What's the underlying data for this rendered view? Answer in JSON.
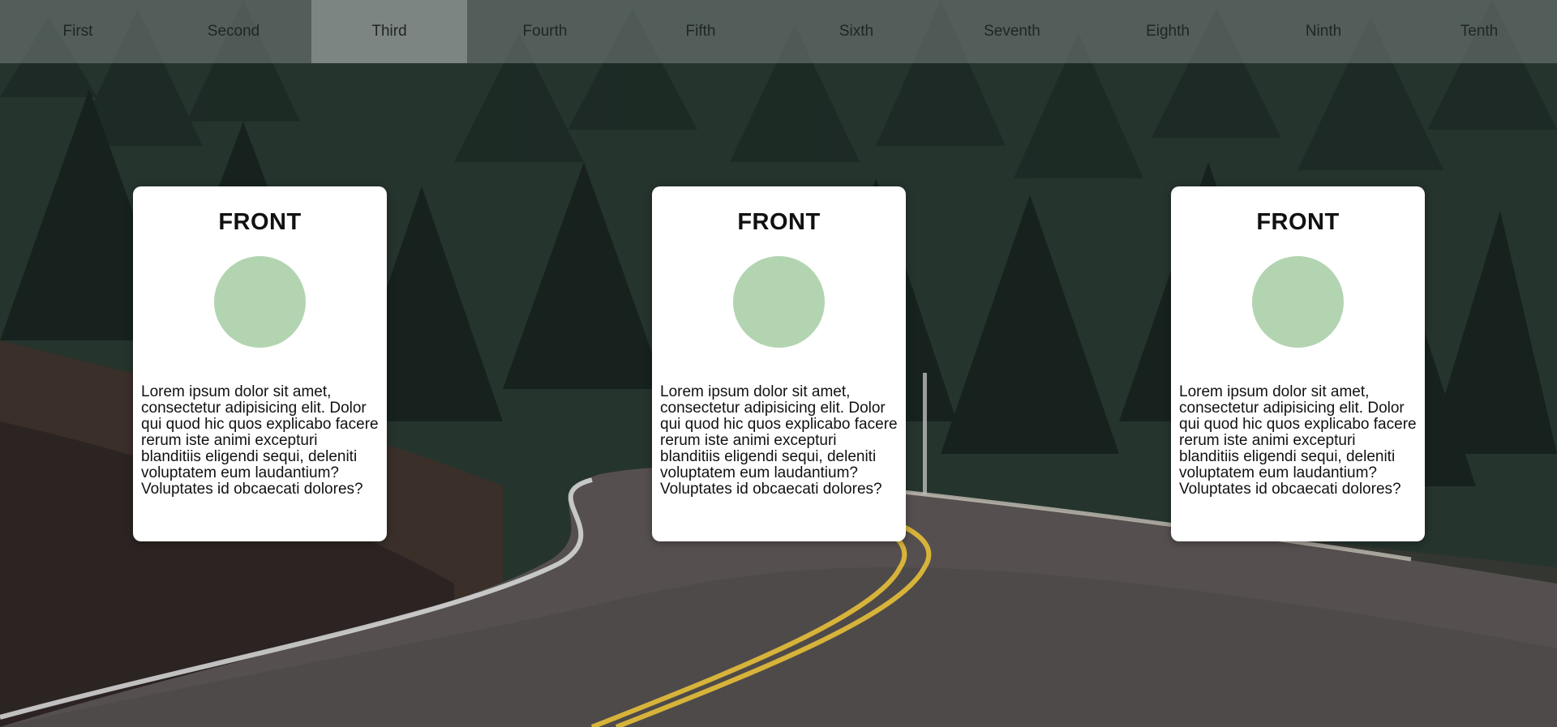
{
  "colors": {
    "nav_background": "#7a8382",
    "card_background": "#ffffff",
    "circle_fill": "#b3d4b0",
    "road_line_yellow": "#d7b33a",
    "road_edge_white": "#e6e6e6"
  },
  "nav": {
    "items": [
      {
        "label": "First",
        "active": false
      },
      {
        "label": "Second",
        "active": false
      },
      {
        "label": "Third",
        "active": true
      },
      {
        "label": "Fourth",
        "active": false
      },
      {
        "label": "Fifth",
        "active": false
      },
      {
        "label": "Sixth",
        "active": false
      },
      {
        "label": "Seventh",
        "active": false
      },
      {
        "label": "Eighth",
        "active": false
      },
      {
        "label": "Ninth",
        "active": false
      },
      {
        "label": "Tenth",
        "active": false
      }
    ]
  },
  "cards": [
    {
      "title": "FRONT",
      "text": "Lorem ipsum dolor sit amet, consectetur adipisicing elit. Dolor qui quod hic quos explicabo facere rerum iste animi excepturi blanditiis eligendi sequi, deleniti voluptatem eum laudantium? Voluptates id obcaecati dolores?"
    },
    {
      "title": "FRONT",
      "text": "Lorem ipsum dolor sit amet, consectetur adipisicing elit. Dolor qui quod hic quos explicabo facere rerum iste animi excepturi blanditiis eligendi sequi, deleniti voluptatem eum laudantium? Voluptates id obcaecati dolores?"
    },
    {
      "title": "FRONT",
      "text": "Lorem ipsum dolor sit amet, consectetur adipisicing elit. Dolor qui quod hic quos explicabo facere rerum iste animi excepturi blanditiis eligendi sequi, deleniti voluptatem eum laudantium? Voluptates id obcaecati dolores?"
    }
  ]
}
